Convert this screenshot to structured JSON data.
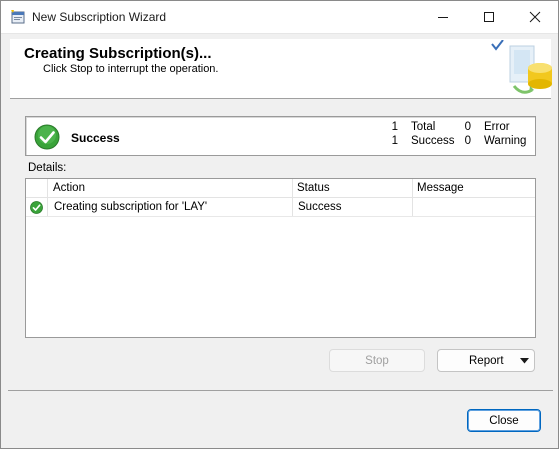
{
  "window": {
    "title": "New Subscription Wizard"
  },
  "banner": {
    "title": "Creating Subscription(s)...",
    "subtitle": "Click Stop to interrupt the operation."
  },
  "status": {
    "label": "Success",
    "total_count": "1",
    "total_label": "Total",
    "success_count": "1",
    "success_label": "Success",
    "error_count": "0",
    "error_label": "Error",
    "warning_count": "0",
    "warning_label": "Warning"
  },
  "details": {
    "label": "Details:",
    "columns": [
      "Action",
      "Status",
      "Message"
    ],
    "rows": [
      {
        "icon": "success-check-icon",
        "action": "Creating subscription for 'LAY'",
        "status": "Success",
        "message": ""
      }
    ]
  },
  "buttons": {
    "stop": "Stop",
    "report": "Report",
    "close": "Close"
  },
  "colors": {
    "success_green": "#3aa33a",
    "accent_blue": "#0067c0"
  }
}
